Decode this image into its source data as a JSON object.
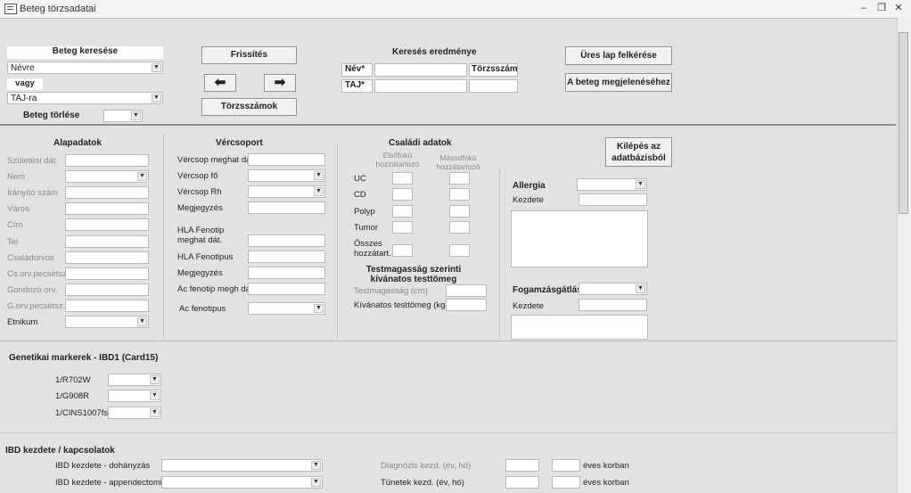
{
  "window": {
    "title": "Beteg törzsadatai",
    "minimize": "–",
    "restore": "❐",
    "close": "✕"
  },
  "search": {
    "header": "Beteg keresése",
    "by_name_value": "Névre",
    "or_label": "vagy",
    "by_taj_value": "TAJ-ra",
    "delete_label": "Beteg törlése"
  },
  "buttons": {
    "refresh": "Frissítés",
    "prev_arrow": "⬅",
    "next_arrow": "➡",
    "registry_numbers": "Törzsszámok",
    "empty_page": "Üres lap felkérése",
    "show_patient": "A beteg megjelenéséhez",
    "exit_line1": "Kilépés az",
    "exit_line2": "adatbázisból"
  },
  "results": {
    "header": "Keresés eredménye",
    "name_label": "Név*",
    "taj_label": "TAJ*",
    "registry_label": "Törzsszám"
  },
  "basic": {
    "header": "Alapadatok",
    "fields": [
      "Születési dát.",
      "Nem",
      "Irányító szám",
      "Város",
      "Cím",
      "Tel",
      "Családorvos",
      "Cs.orv.pecsétsz.",
      "Gondozó orv.",
      "G.orv.pecsétsz.",
      "Etnikum"
    ]
  },
  "blood": {
    "header": "Vércsoport",
    "fields": [
      "Vércsop meghat dát.",
      "Vércsop fő",
      "Vércsop Rh",
      "Megjegyzés",
      "HLA Fenotip meghat dát.",
      "HLA Fenotipus",
      "Megjegyzés",
      "Ac fenotip megh dát.",
      "Ac fenotipus"
    ],
    "hla_date_line1": "HLA Fenotip",
    "hla_date_line2": "meghat dát."
  },
  "family": {
    "header": "Családi adatok",
    "col1_line1": "Elsőfokú",
    "col1_line2": "hozzátartozó",
    "col2_line1": "Másodfokú",
    "col2_line2": "hozzátartozó",
    "rows": [
      "UC",
      "CD",
      "Polyp",
      "Tumor"
    ],
    "total_line1": "Összes",
    "total_line2": "hozzátart."
  },
  "height": {
    "header_line1": "Testmagasság szerinti",
    "header_line2": "kívánatos testtömeg",
    "height_label": "Testmagasság (cm)",
    "weight_label": "Kívánatos testtömeg (kg)"
  },
  "allergy": {
    "label": "Allergia",
    "start_label": "Kezdete"
  },
  "periodontal": {
    "label": "Fogamzásgátlás",
    "start_label": "Kezdete"
  },
  "genetic": {
    "header": "Genetikai markerek - IBD1 (Card15)",
    "markers": [
      "1/R702W",
      "1/G908R",
      "1/CINS1007fs"
    ]
  },
  "ibd": {
    "header": "IBD kezdete / kapcsolatok",
    "smoking": "IBD kezdete - dohányzás",
    "appendectomy": "IBD kezdete - appendectomia",
    "diagnosis_start": "Diagnózis kezd. (év, hó)",
    "symptom_start": "Tünetek kezd. (év, hó)",
    "age_suffix": "éves korban"
  },
  "icons": {
    "dropdown": "▼"
  }
}
